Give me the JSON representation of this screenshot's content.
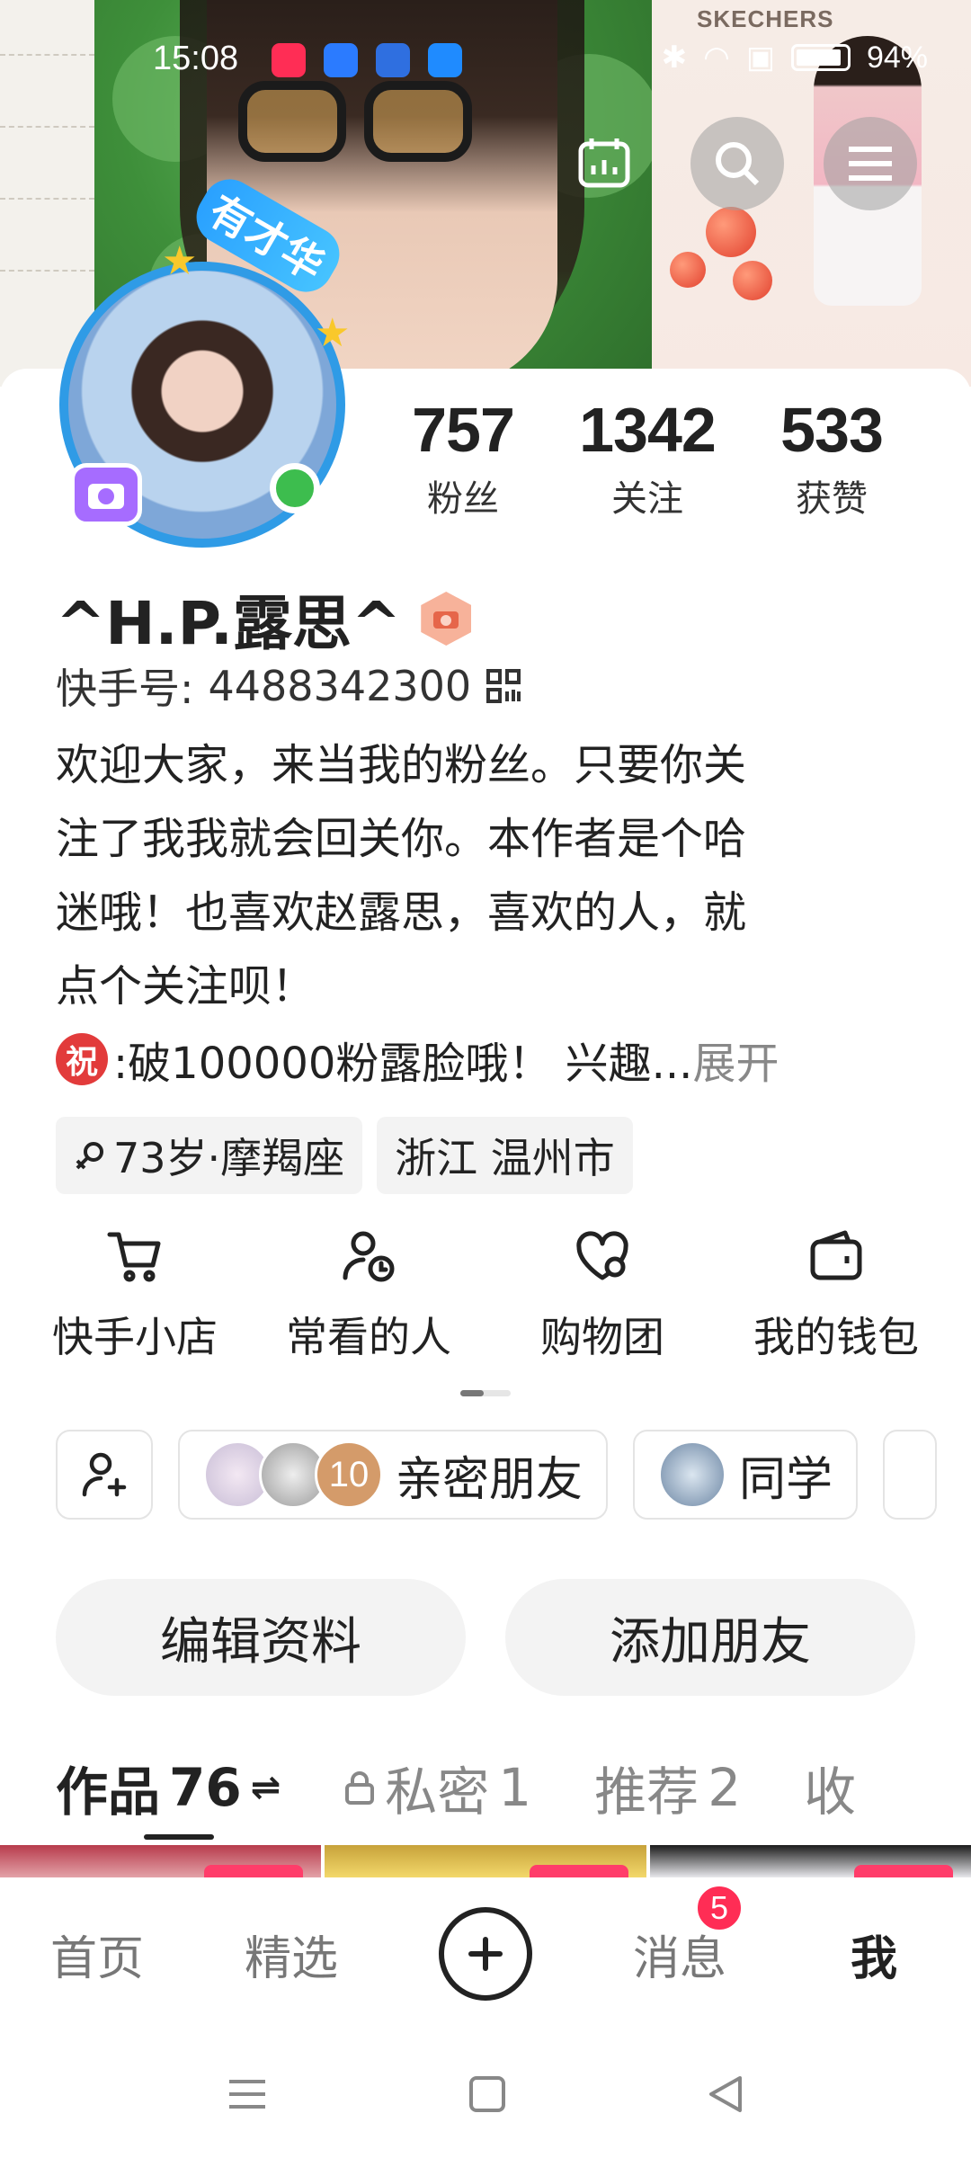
{
  "status_bar": {
    "time": "15:08",
    "battery": "94%"
  },
  "banner": {
    "poster_brand": "SKECHERS"
  },
  "profile": {
    "avatar_badge": "有才华",
    "stats": [
      {
        "value": "757",
        "label": "粉丝"
      },
      {
        "value": "1342",
        "label": "关注"
      },
      {
        "value": "533",
        "label": "获赞"
      }
    ],
    "name": "^H.P.露思^",
    "id_label": "快手号:",
    "id_value": "4488342300",
    "bio_lines": [
      "欢迎大家，来当我的粉丝。只要你关",
      "注了我我就会回关你。本作者是个哈",
      "迷哦！也喜欢赵露思，喜欢的人，就",
      "点个关注呗！"
    ],
    "bio_last": ":破100000粉露脸哦！ 兴趣...",
    "bio_emoji": "祝",
    "expand_label": "展开",
    "tags": [
      "73岁·摩羯座",
      "浙江 温州市"
    ]
  },
  "shortcuts": [
    {
      "label": "快手小店",
      "icon": "cart-icon"
    },
    {
      "label": "常看的人",
      "icon": "person-clock-icon"
    },
    {
      "label": "购物团",
      "icon": "heart-group-icon"
    },
    {
      "label": "我的钱包",
      "icon": "wallet-icon"
    }
  ],
  "friend_chips": {
    "close_friends": {
      "label": "亲密朋友",
      "count": "10"
    },
    "classmates": {
      "label": "同学"
    }
  },
  "actions": {
    "edit_profile": "编辑资料",
    "add_friend": "添加朋友"
  },
  "tabs": {
    "works": {
      "label": "作品",
      "count": "76"
    },
    "private": {
      "label": "私密",
      "count": "1"
    },
    "recommend": {
      "label": "推荐",
      "count": "2"
    },
    "collect": {
      "label": "收"
    }
  },
  "bottom_nav": {
    "home": "首页",
    "featured": "精选",
    "messages": "消息",
    "messages_badge": "5",
    "me": "我"
  },
  "colors": {
    "accent": "#ff2d55",
    "online": "#3dbd4e",
    "avatar_ring": "#2f9be6"
  }
}
